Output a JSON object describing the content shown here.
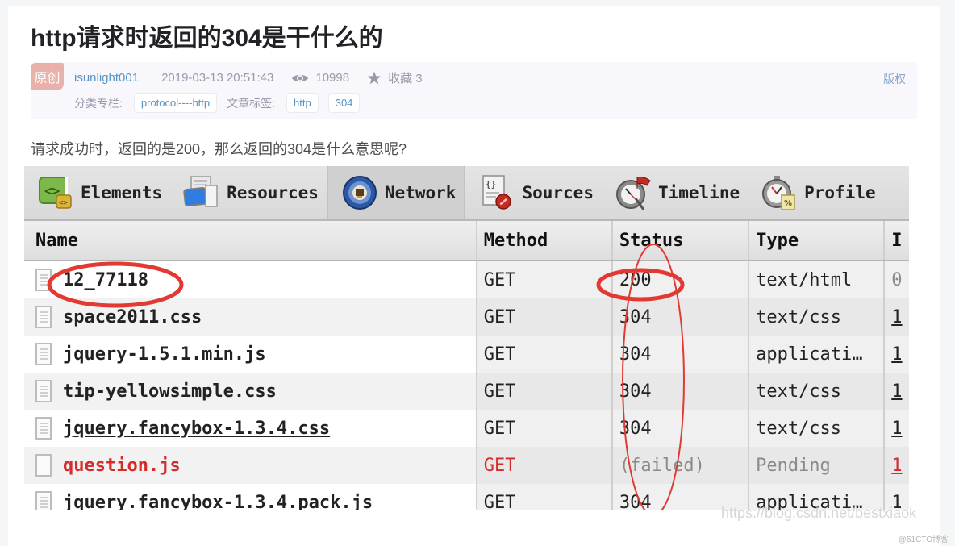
{
  "article": {
    "title": "http请求时返回的304是干什么的",
    "badge": "原创",
    "author": "isunlight001",
    "datetime": "2019-03-13 20:51:43",
    "views": "10998",
    "favorites_label": "收藏 3",
    "copyright": "版权",
    "category_label": "分类专栏:",
    "categories": [
      "protocol----http"
    ],
    "tags_label": "文章标签:",
    "tags": [
      "http",
      "304"
    ],
    "intro": "请求成功时，返回的是200，那么返回的304是什么意思呢?"
  },
  "icons": {
    "views": "eye-icon",
    "favorites": "star-icon"
  },
  "devtools": {
    "tabs": [
      {
        "label": "Elements",
        "icon": "elements-icon",
        "active": false
      },
      {
        "label": "Resources",
        "icon": "resources-icon",
        "active": false
      },
      {
        "label": "Network",
        "icon": "network-icon",
        "active": true
      },
      {
        "label": "Sources",
        "icon": "sources-icon",
        "active": false
      },
      {
        "label": "Timeline",
        "icon": "timeline-icon",
        "active": false
      },
      {
        "label": "Profile",
        "icon": "profiles-icon",
        "active": false
      }
    ],
    "columns": [
      "Name",
      "Method",
      "Status",
      "Type",
      "I"
    ],
    "rows": [
      {
        "name": "12_77118",
        "method": "GET",
        "status": "200",
        "type": "text/html",
        "extra": "0",
        "state": "normal"
      },
      {
        "name": "space2011.css",
        "method": "GET",
        "status": "304",
        "type": "text/css",
        "extra": "1",
        "state": "normal"
      },
      {
        "name": "jquery-1.5.1.min.js",
        "method": "GET",
        "status": "304",
        "type": "applicati…",
        "extra": "1",
        "state": "normal"
      },
      {
        "name": "tip-yellowsimple.css",
        "method": "GET",
        "status": "304",
        "type": "text/css",
        "extra": "1",
        "state": "normal"
      },
      {
        "name": "jquery.fancybox-1.3.4.css",
        "method": "GET",
        "status": "304",
        "type": "text/css",
        "extra": "1",
        "state": "underlined"
      },
      {
        "name": "question.js",
        "method": "GET",
        "status": "(failed)",
        "type": "Pending",
        "extra": "1",
        "state": "error"
      },
      {
        "name": "jquery.fancybox-1.3.4.pack.js",
        "method": "GET",
        "status": "304",
        "type": "applicati…",
        "extra": "1",
        "state": "normal"
      }
    ],
    "annotation_color": "#e23a32"
  },
  "watermarks": {
    "csdn": "https://blog.csdn.net/bestxiaok",
    "site": "@51CTO博客"
  }
}
